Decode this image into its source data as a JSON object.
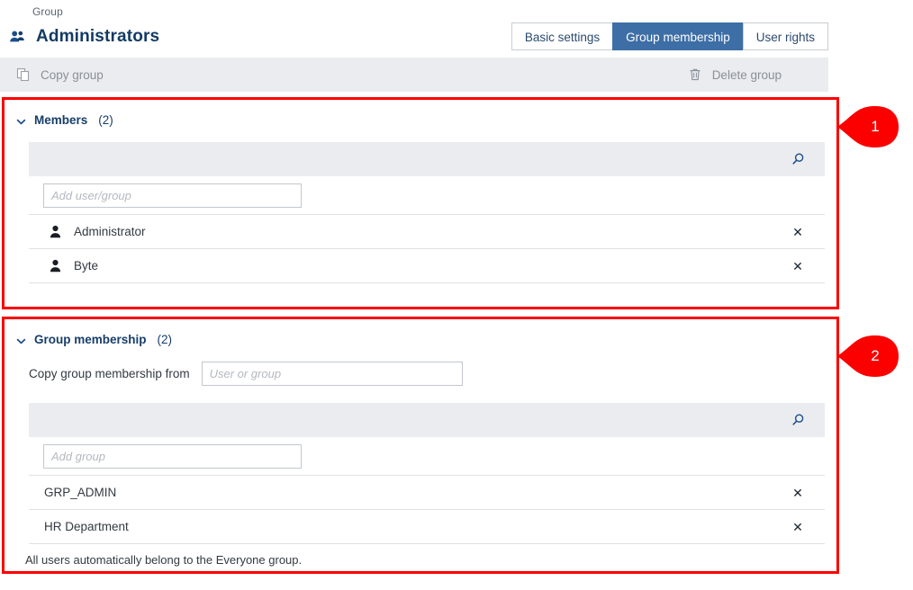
{
  "header": {
    "breadcrumb": "Group",
    "title": "Administrators",
    "group_icon": "group-users-icon"
  },
  "tabs": [
    {
      "label": "Basic settings",
      "active": false
    },
    {
      "label": "Group membership",
      "active": true
    },
    {
      "label": "User rights",
      "active": false
    }
  ],
  "toolbar": {
    "copy_group_label": "Copy group",
    "copy_group_icon": "copy-icon",
    "delete_group_label": "Delete group",
    "delete_group_icon": "trash-icon"
  },
  "members_section": {
    "title": "Members",
    "count": "(2)",
    "chevron_icon": "chevron-down-icon",
    "search_icon": "search-icon",
    "add_placeholder": "Add user/group",
    "add_value": "",
    "rows": [
      {
        "label": "Administrator",
        "icon": "person-icon",
        "remove": "✕"
      },
      {
        "label": "Byte",
        "icon": "person-icon",
        "remove": "✕"
      }
    ]
  },
  "group_membership_section": {
    "title": "Group membership",
    "count": "(2)",
    "chevron_icon": "chevron-down-icon",
    "copy_from_label": "Copy group membership from",
    "copy_from_placeholder": "User or group",
    "copy_from_value": "",
    "search_icon": "search-icon",
    "add_placeholder": "Add group",
    "add_value": "",
    "rows": [
      {
        "label": "GRP_ADMIN",
        "remove": "✕"
      },
      {
        "label": "HR Department",
        "remove": "✕"
      }
    ],
    "footnote": "All users automatically belong to the Everyone group."
  },
  "annotations": [
    {
      "number": "1",
      "color": "#fc0000"
    },
    {
      "number": "2",
      "color": "#fc0000"
    }
  ],
  "colors": {
    "accent_blue": "#3d6ea5",
    "title_blue": "#133a64",
    "toolbar_gray": "#eaecef",
    "annotation_red": "#fc0000"
  }
}
